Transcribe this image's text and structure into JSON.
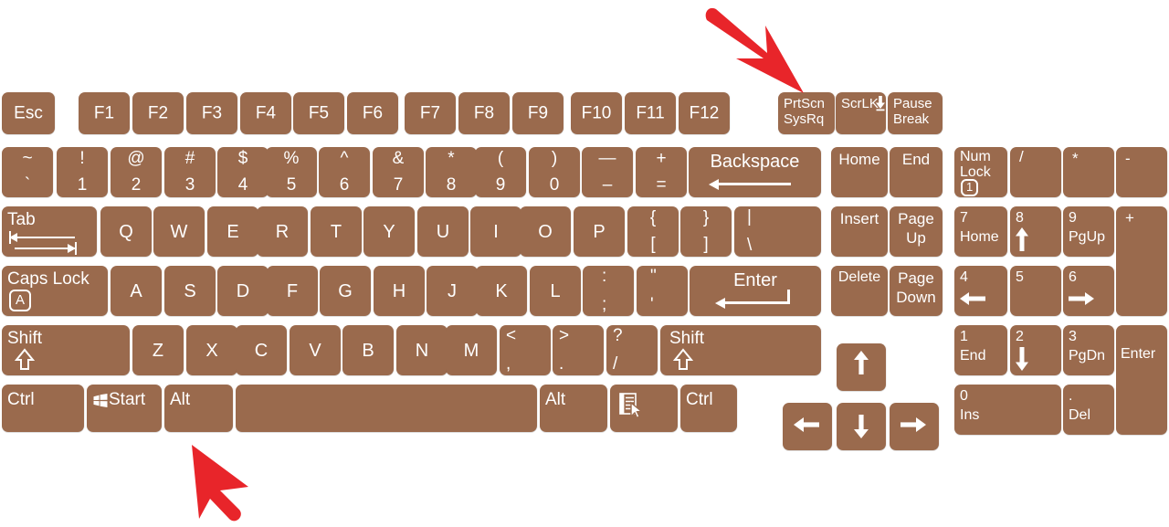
{
  "diagram": {
    "title": "Computer keyboard layout diagram",
    "key_color": "#9a6a4d",
    "text_color": "#ffffff",
    "background": "#ffffff",
    "annotation_color": "#e8252a"
  },
  "annotations": [
    {
      "name": "prtscn-pointer",
      "points_to": "PrtScn SysRq",
      "direction": "down-right"
    },
    {
      "name": "alt-pointer",
      "points_to": "Alt",
      "direction": "up-right"
    }
  ],
  "rows": {
    "function_row": {
      "esc": "Esc",
      "f_keys": [
        "F1",
        "F2",
        "F3",
        "F4",
        "F5",
        "F6",
        "F7",
        "F8",
        "F9",
        "F10",
        "F11",
        "F12"
      ],
      "prtscn": {
        "line1": "PrtScn",
        "line2": "SysRq"
      },
      "scrlk": {
        "line1": "ScrLK"
      },
      "pause": {
        "line1": "Pause",
        "line2": "Break"
      }
    },
    "number_row": {
      "keys": [
        {
          "shift": "~",
          "base": "`"
        },
        {
          "shift": "!",
          "base": "1"
        },
        {
          "shift": "@",
          "base": "2"
        },
        {
          "shift": "#",
          "base": "3"
        },
        {
          "shift": "$",
          "base": "4"
        },
        {
          "shift": "%",
          "base": "5"
        },
        {
          "shift": "^",
          "base": "6"
        },
        {
          "shift": "&",
          "base": "7"
        },
        {
          "shift": "*",
          "base": "8"
        },
        {
          "shift": "(",
          "base": "9"
        },
        {
          "shift": ")",
          "base": "0"
        },
        {
          "shift": "—",
          "base": "–"
        },
        {
          "shift": "+",
          "base": "="
        }
      ],
      "backspace": "Backspace"
    },
    "top_row": {
      "tab": "Tab",
      "letters": [
        "Q",
        "W",
        "E",
        "R",
        "T",
        "Y",
        "U",
        "I",
        "O",
        "P"
      ],
      "bracket_left": {
        "shift": "{",
        "base": "["
      },
      "bracket_right": {
        "shift": "}",
        "base": "]"
      },
      "backslash": {
        "shift": "|",
        "base": "\\"
      }
    },
    "home_row": {
      "caps_lock": "Caps Lock",
      "caps_indicator": "A",
      "letters": [
        "A",
        "S",
        "D",
        "F",
        "G",
        "H",
        "J",
        "K",
        "L"
      ],
      "semicolon": {
        "shift": ":",
        "base": ";"
      },
      "quote": {
        "shift": "\"",
        "base": "'"
      },
      "enter": "Enter"
    },
    "bottom_letter_row": {
      "shift_left": "Shift",
      "letters": [
        "Z",
        "X",
        "C",
        "V",
        "B",
        "N",
        "M"
      ],
      "comma": {
        "shift": "<",
        "base": ","
      },
      "period": {
        "shift": ">",
        "base": "."
      },
      "slash": {
        "shift": "?",
        "base": "/"
      },
      "shift_right": "Shift"
    },
    "modifier_row": {
      "ctrl_left": "Ctrl",
      "start": "Start",
      "alt_left": "Alt",
      "space": "",
      "alt_right": "Alt",
      "menu": "",
      "ctrl_right": "Ctrl"
    }
  },
  "nav_cluster": {
    "home": "Home",
    "end": "End",
    "insert": "Insert",
    "page_up": {
      "line1": "Page",
      "line2": "Up"
    },
    "delete": "Delete",
    "page_down": {
      "line1": "Page",
      "line2": "Down"
    }
  },
  "arrow_cluster": {
    "up": "↑",
    "left": "←",
    "down": "↓",
    "right": "→"
  },
  "numpad": {
    "num_lock": {
      "line1": "Num",
      "line2": "Lock",
      "indicator": "1"
    },
    "divide": "/",
    "multiply": "*",
    "subtract": "-",
    "add": "+",
    "enter": "Enter",
    "n7": {
      "digit": "7",
      "alt": "Home"
    },
    "n8": {
      "digit": "8",
      "alt": "↑"
    },
    "n9": {
      "digit": "9",
      "alt": "PgUp"
    },
    "n4": {
      "digit": "4",
      "alt": "←"
    },
    "n5": {
      "digit": "5",
      "alt": ""
    },
    "n6": {
      "digit": "6",
      "alt": "→"
    },
    "n1": {
      "digit": "1",
      "alt": "End"
    },
    "n2": {
      "digit": "2",
      "alt": "↓"
    },
    "n3": {
      "digit": "3",
      "alt": "PgDn"
    },
    "n0": {
      "digit": "0",
      "alt": "Ins"
    },
    "decimal": {
      "digit": ".",
      "alt": "Del"
    }
  }
}
